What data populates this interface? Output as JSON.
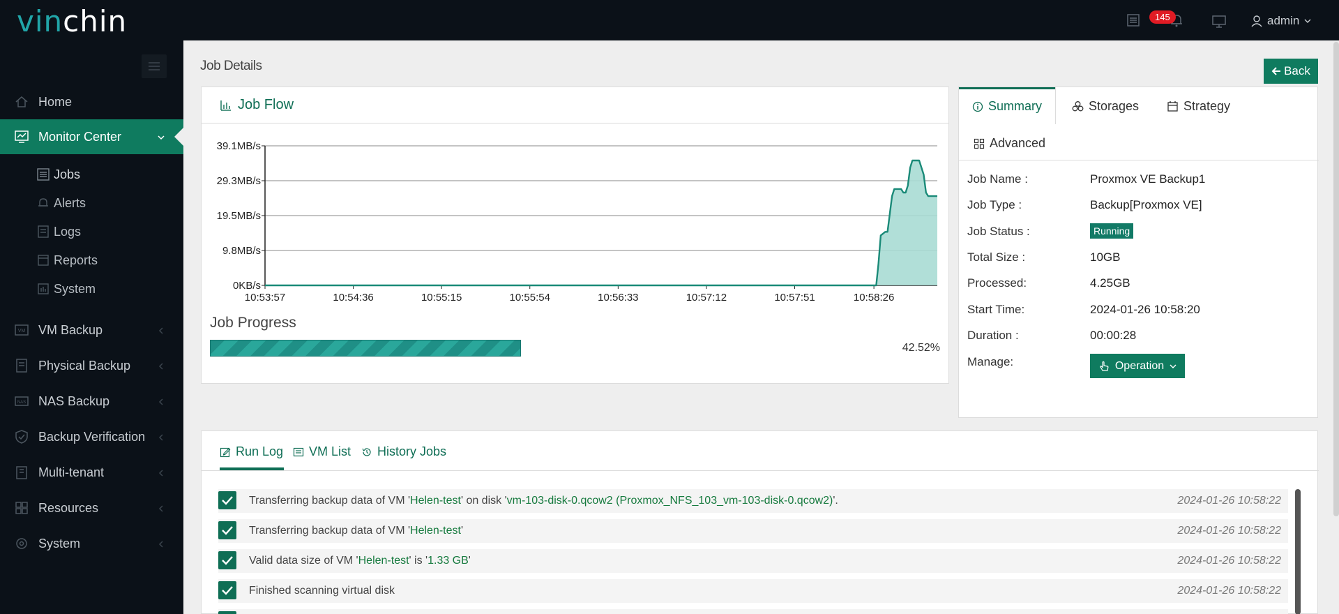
{
  "brand": {
    "logo_part1": "vin",
    "logo_part2": "chin"
  },
  "topbar": {
    "notifications_count": "145",
    "user": "admin"
  },
  "sidebar": {
    "items": [
      {
        "label": "Home"
      },
      {
        "label": "Monitor Center"
      },
      {
        "label": "VM Backup"
      },
      {
        "label": "Physical Backup"
      },
      {
        "label": "NAS Backup"
      },
      {
        "label": "Backup Verification"
      },
      {
        "label": "Multi-tenant"
      },
      {
        "label": "Resources"
      },
      {
        "label": "System"
      }
    ],
    "monitor_sub": [
      {
        "label": "Jobs"
      },
      {
        "label": "Alerts"
      },
      {
        "label": "Logs"
      },
      {
        "label": "Reports"
      },
      {
        "label": "System"
      }
    ]
  },
  "page": {
    "title": "Job Details",
    "back_label": "Back"
  },
  "flow": {
    "title": "Job Flow",
    "progress_title": "Job Progress",
    "progress_pct_label": "42.52%",
    "progress_fraction": 0.4252
  },
  "chart_data": {
    "type": "area",
    "title": "",
    "xlabel": "",
    "ylabel": "",
    "y_ticks": [
      "0KB/s",
      "9.8MB/s",
      "19.5MB/s",
      "29.3MB/s",
      "39.1MB/s"
    ],
    "ylim": [
      0,
      39.1
    ],
    "x_ticks": [
      "10:53:57",
      "10:54:36",
      "10:55:15",
      "10:55:54",
      "10:56:33",
      "10:57:12",
      "10:57:51",
      "10:58:26"
    ],
    "x_seconds": [
      0,
      39,
      78,
      117,
      156,
      195,
      234,
      269,
      270,
      271,
      272,
      274,
      275,
      277,
      278,
      280,
      281,
      282,
      283,
      284,
      285,
      286,
      288,
      289,
      290,
      291,
      292,
      293,
      294,
      295,
      296,
      297
    ],
    "values": [
      0,
      0,
      0,
      0,
      0,
      0,
      0,
      0,
      0,
      6,
      14,
      15,
      15,
      25,
      27,
      27,
      27,
      26,
      26,
      28,
      33,
      35,
      35,
      35,
      33,
      31,
      26,
      25,
      25,
      25,
      25,
      25
    ],
    "unit": "MB/s"
  },
  "summary": {
    "tabs": [
      "Summary",
      "Storages",
      "Strategy",
      "Advanced"
    ],
    "rows": [
      {
        "label": "Job Name :",
        "value": "Proxmox VE Backup1"
      },
      {
        "label": "Job Type :",
        "value": "Backup[Proxmox VE]"
      },
      {
        "label": "Job Status :",
        "value": "Running"
      },
      {
        "label": "Total Size :",
        "value": "10GB"
      },
      {
        "label": "Processed:",
        "value": "4.25GB"
      },
      {
        "label": "Start Time:",
        "value": "2024-01-26 10:58:20"
      },
      {
        "label": "Duration :",
        "value": "00:00:28"
      },
      {
        "label": "Manage:",
        "value": "Operation"
      }
    ]
  },
  "log": {
    "tabs": [
      "Run Log",
      "VM List",
      "History Jobs"
    ],
    "rows": [
      {
        "parts": [
          "Transferring backup data of VM '",
          "Helen-test",
          "' on disk '",
          "vm-103-disk-0.qcow2 (Proxmox_NFS_103_vm-103-disk-0.qcow2)",
          "'."
        ],
        "time": "2024-01-26 10:58:22"
      },
      {
        "parts": [
          "Transferring backup data of VM '",
          "Helen-test",
          "'",
          "",
          ""
        ],
        "time": "2024-01-26 10:58:22"
      },
      {
        "parts": [
          "Valid data size of VM '",
          "Helen-test",
          "' is '",
          "1.33 GB",
          "'"
        ],
        "time": "2024-01-26 10:58:22"
      },
      {
        "parts": [
          "Finished scanning virtual disk",
          "",
          "",
          "",
          ""
        ],
        "time": "2024-01-26 10:58:22"
      }
    ]
  },
  "colors": {
    "accent": "#0f7b5f",
    "sidebar_bg": "#0b1118",
    "chart_fill": "#a9dbd4",
    "chart_line": "#1a8a78",
    "badge": "#e01b24"
  }
}
